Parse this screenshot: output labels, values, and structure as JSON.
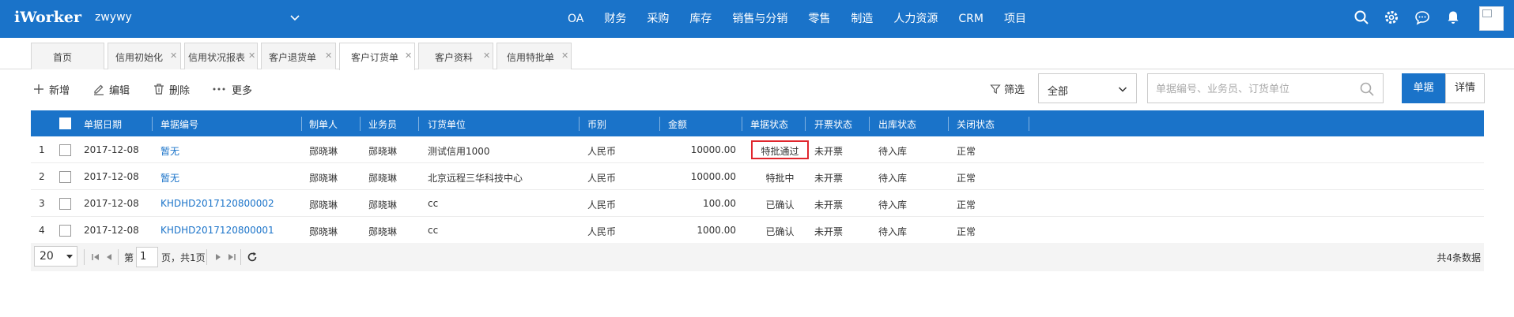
{
  "app": {
    "logo": "iWorker",
    "company": "zwywy"
  },
  "nav": {
    "items": [
      "OA",
      "财务",
      "采购",
      "库存",
      "销售与分销",
      "零售",
      "制造",
      "人力资源",
      "CRM",
      "项目"
    ]
  },
  "tabs": [
    {
      "label": "首页",
      "closable": false
    },
    {
      "label": "信用初始化",
      "closable": true
    },
    {
      "label": "信用状况报表",
      "closable": true
    },
    {
      "label": "客户退货单",
      "closable": true
    },
    {
      "label": "客户订货单",
      "closable": true,
      "active": true
    },
    {
      "label": "客户资料",
      "closable": true
    },
    {
      "label": "信用特批单",
      "closable": true
    }
  ],
  "toolbar": {
    "add_label": "新增",
    "edit_label": "编辑",
    "delete_label": "删除",
    "more_label": "更多",
    "filter_label": "筛选",
    "status_select": "全部",
    "search_placeholder": "单据编号、业务员、订货单位",
    "view_primary": "单据",
    "view_secondary": "详情"
  },
  "table": {
    "columns": [
      "单据日期",
      "单据编号",
      "制单人",
      "业务员",
      "订货单位",
      "币别",
      "金额",
      "单据状态",
      "开票状态",
      "出库状态",
      "关闭状态"
    ],
    "rows": [
      {
        "index": "1",
        "date": "2017-12-08",
        "code": "暂无",
        "maker": "郧晓琳",
        "salesman": "郧晓琳",
        "customer": "测试信用1000",
        "currency": "人民币",
        "amount": "10000.00",
        "status": "特批通过",
        "invoice": "未开票",
        "outbound": "待入库",
        "closed": "正常"
      },
      {
        "index": "2",
        "date": "2017-12-08",
        "code": "暂无",
        "maker": "郧晓琳",
        "salesman": "郧晓琳",
        "customer": "北京远程三华科技中心",
        "currency": "人民币",
        "amount": "10000.00",
        "status": "特批中",
        "invoice": "未开票",
        "outbound": "待入库",
        "closed": "正常"
      },
      {
        "index": "3",
        "date": "2017-12-08",
        "code": "KHDHD2017120800002",
        "maker": "郧晓琳",
        "salesman": "郧晓琳",
        "customer": "cc",
        "currency": "人民币",
        "amount": "100.00",
        "status": "已确认",
        "invoice": "未开票",
        "outbound": "待入库",
        "closed": "正常"
      },
      {
        "index": "4",
        "date": "2017-12-08",
        "code": "KHDHD2017120800001",
        "maker": "郧晓琳",
        "salesman": "郧晓琳",
        "customer": "cc",
        "currency": "人民币",
        "amount": "1000.00",
        "status": "已确认",
        "invoice": "未开票",
        "outbound": "待入库",
        "closed": "正常"
      }
    ]
  },
  "pager": {
    "page_size": "20",
    "page_prefix": "第",
    "page_current": "1",
    "page_suffix": "页，共1页",
    "total": "共4条数据"
  },
  "colors": {
    "primary": "#1a73c9",
    "highlight": "#e0262d"
  }
}
